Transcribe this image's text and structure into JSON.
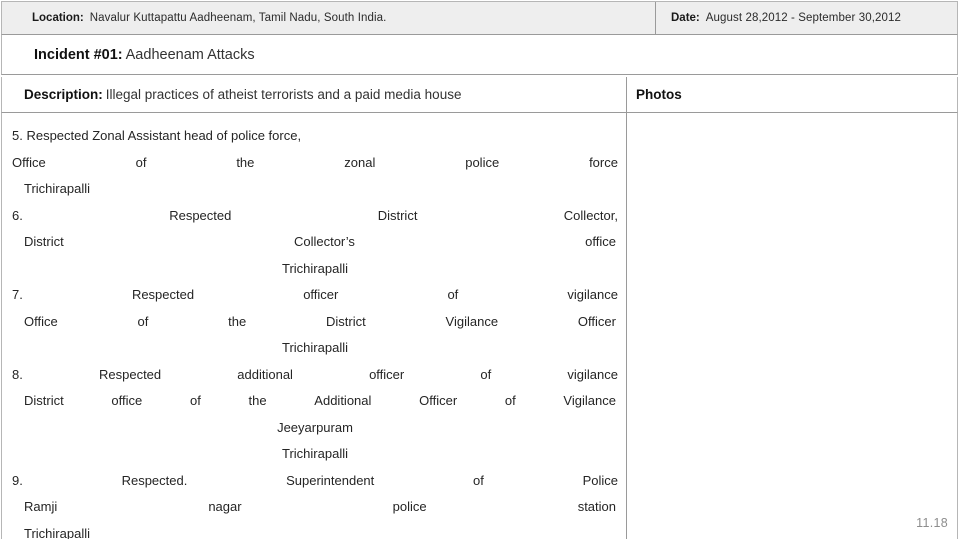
{
  "header": {
    "location_label": "Location:",
    "location_value": "Navalur Kuttapattu  Aadheenam, Tamil Nadu, South India.",
    "date_label": "Date:",
    "date_value": "August 28,2012 - September 30,2012"
  },
  "incident": {
    "label": "Incident #01:",
    "title": "Aadheenam Attacks"
  },
  "columns": {
    "description_label": "Description:",
    "description_value": "Illegal practices of atheist terrorists and a paid media house",
    "photos_label": "Photos"
  },
  "entries": [
    {
      "number": "5.",
      "lines": [
        {
          "align": "left",
          "words": [
            "5. Respected Zonal Assistant head of police force,"
          ]
        },
        {
          "align": "justify",
          "words": [
            "Office",
            "of",
            "the",
            "zonal",
            "police",
            "force"
          ]
        },
        {
          "align": "left",
          "indent": true,
          "words": [
            "Trichirapalli"
          ]
        }
      ]
    },
    {
      "number": "6.",
      "lines": [
        {
          "align": "justify",
          "words": [
            "6.",
            "Respected",
            "District",
            "Collector,"
          ]
        },
        {
          "align": "justify",
          "indent": true,
          "words": [
            "District",
            "Collector’s",
            "office"
          ]
        },
        {
          "align": "center",
          "words": [
            "Trichirapalli"
          ]
        }
      ]
    },
    {
      "number": "7.",
      "lines": [
        {
          "align": "justify",
          "words": [
            "7.",
            "Respected",
            "officer",
            "of",
            "vigilance"
          ]
        },
        {
          "align": "justify",
          "indent": true,
          "words": [
            "Office",
            "of",
            "the",
            "District",
            "Vigilance",
            "Officer"
          ]
        },
        {
          "align": "center",
          "words": [
            "Trichirapalli"
          ]
        }
      ]
    },
    {
      "number": "8.",
      "lines": [
        {
          "align": "justify",
          "words": [
            "8.",
            "Respected",
            "additional",
            "officer",
            "of",
            "vigilance"
          ]
        },
        {
          "align": "justify",
          "indent": true,
          "words": [
            "District",
            "office",
            "of",
            "the",
            "Additional",
            "Officer",
            "of",
            "Vigilance"
          ]
        },
        {
          "align": "center",
          "words": [
            "Jeeyarpuram"
          ]
        },
        {
          "align": "center",
          "words": [
            "Trichirapalli"
          ]
        }
      ]
    },
    {
      "number": "9.",
      "lines": [
        {
          "align": "justify",
          "words": [
            "9.",
            "Respected.",
            "Superintendent",
            "of",
            "Police"
          ]
        },
        {
          "align": "justify",
          "indent": true,
          "words": [
            "Ramji",
            "nagar",
            "police",
            "station"
          ]
        },
        {
          "align": "left",
          "indent": true,
          "words": [
            "Trichirapalli"
          ]
        }
      ]
    }
  ],
  "footer": {
    "page_number": "11.18"
  }
}
